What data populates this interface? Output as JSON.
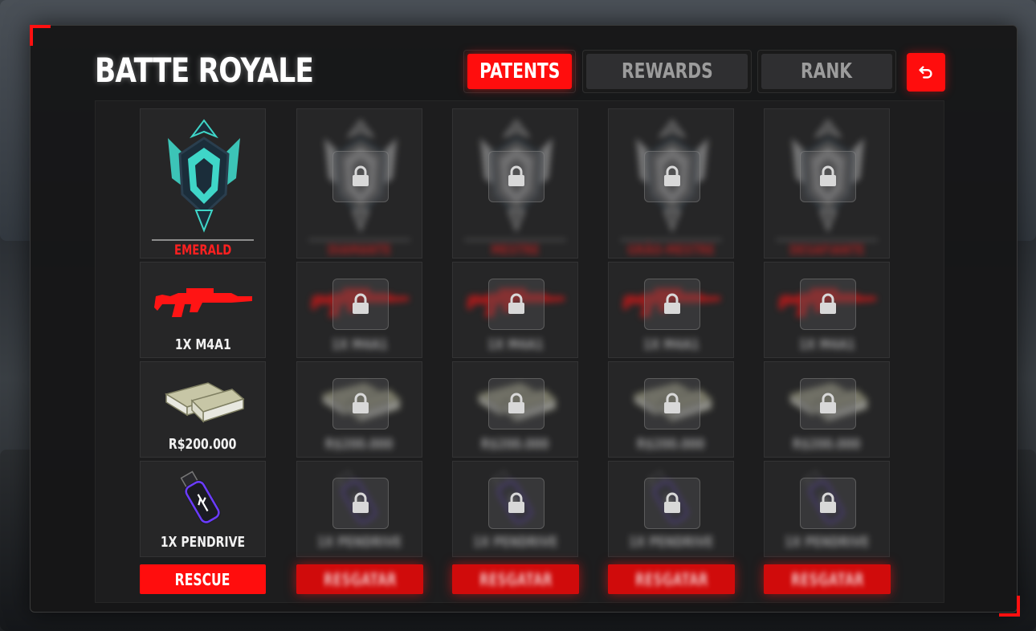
{
  "header": {
    "title": "BATTE ROYALE",
    "back_icon": "undo-icon"
  },
  "tabs": [
    {
      "label": "PATENTS",
      "active": true
    },
    {
      "label": "REWARDS",
      "active": false
    },
    {
      "label": "RANK",
      "active": false
    }
  ],
  "columns": [
    {
      "rank": "EMERALD",
      "rank_icon": "emerald-rank-icon",
      "locked": false,
      "weapon": "1X M4A1",
      "money": "R$200.000",
      "item": "1X PENDRIVE",
      "button": "RESCUE"
    },
    {
      "rank": "DIAMANTE",
      "rank_icon": "diamond-rank-icon",
      "locked": true,
      "weapon": "1X M4A1",
      "money": "R$200.000",
      "item": "1X PENDRIVE",
      "button": "RESGATAR"
    },
    {
      "rank": "MESTRE",
      "rank_icon": "master-rank-icon",
      "locked": true,
      "weapon": "1X M4A1",
      "money": "R$200.000",
      "item": "1X PENDRIVE",
      "button": "RESGATAR"
    },
    {
      "rank": "GRÃO-MESTRE",
      "rank_icon": "grandmaster-rank-icon",
      "locked": true,
      "weapon": "1X M4A1",
      "money": "R$200.000",
      "item": "1X PENDRIVE",
      "button": "RESGATAR"
    },
    {
      "rank": "DESAFIANTE",
      "rank_icon": "challenger-rank-icon",
      "locked": true,
      "weapon": "1X M4A1",
      "money": "R$200.000",
      "item": "1X PENDRIVE",
      "button": "RESGATAR"
    }
  ],
  "colors": {
    "accent": "#ff0d0d",
    "panel": "#161617",
    "cell": "#262627",
    "emerald": "#3fd6c8"
  }
}
